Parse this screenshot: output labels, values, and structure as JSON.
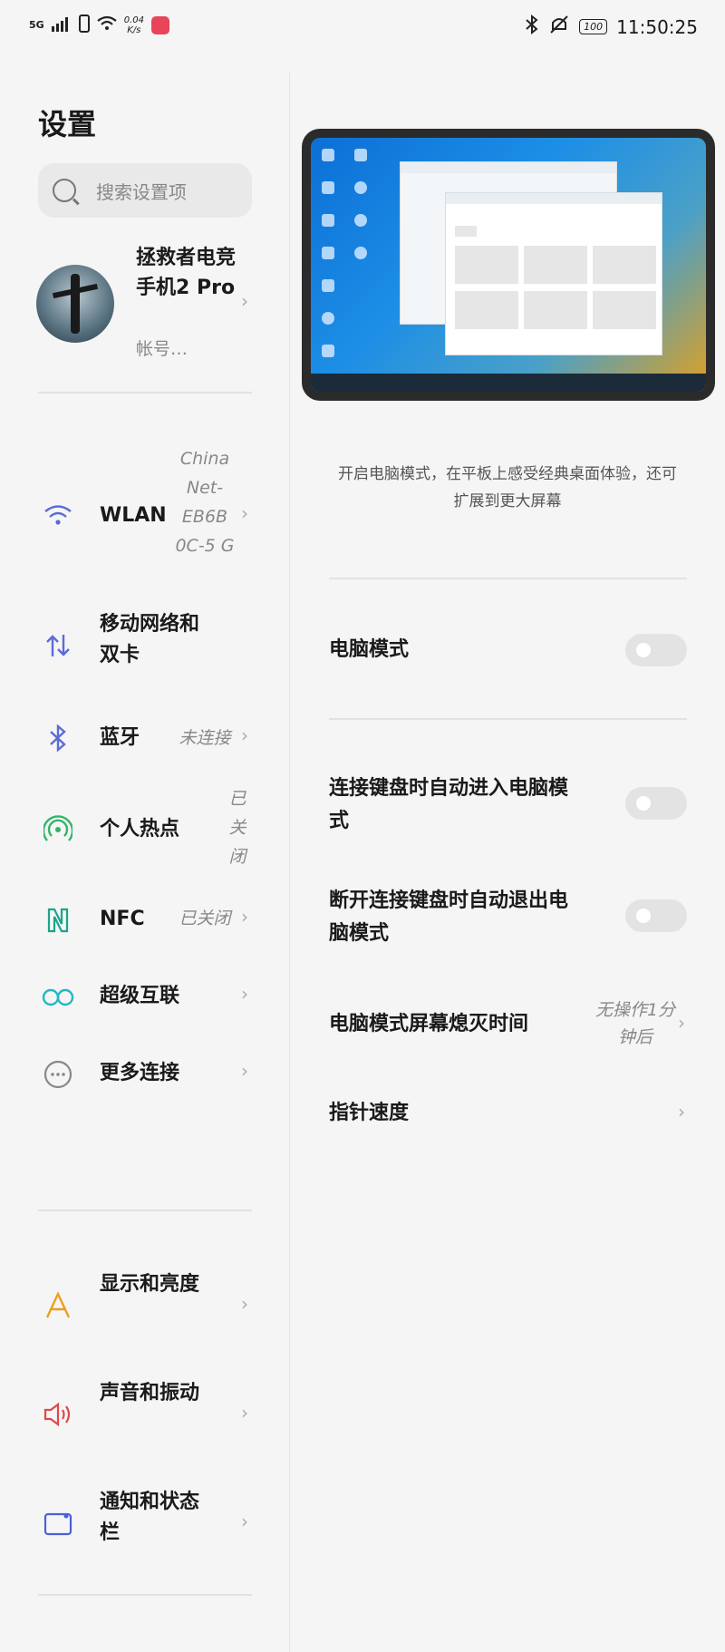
{
  "status_bar": {
    "network": "5G",
    "speed_value": "0.04",
    "speed_unit": "K/s",
    "battery": "100",
    "time": "11:50:25"
  },
  "left": {
    "title": "设置",
    "search_placeholder": "搜索设置项",
    "account": {
      "name": "拯救者电竞手机2 Pro",
      "subtitle": "帐号…"
    },
    "items": [
      {
        "label": "WLAN",
        "value": "China Net-EB6B 0C-5 G",
        "icon": "wifi-icon",
        "color": "#5b6bd8"
      },
      {
        "label": "移动网络和双卡",
        "value": "",
        "icon": "mobile-data-icon",
        "color": "#5b6bd8"
      },
      {
        "label": "蓝牙",
        "value": "未连接",
        "icon": "bluetooth-icon",
        "color": "#5b6bd8"
      },
      {
        "label": "个人热点",
        "value": "已关闭",
        "icon": "hotspot-icon",
        "color": "#2fb56a"
      },
      {
        "label": "NFC",
        "value": "已关闭",
        "icon": "nfc-icon",
        "color": "#1aa58a"
      },
      {
        "label": "超级互联",
        "value": "",
        "icon": "super-connect-icon",
        "color": "#22b8c8"
      },
      {
        "label": "更多连接",
        "value": "",
        "icon": "more-connections-icon",
        "color": "#888888"
      },
      {
        "label": "显示和亮度",
        "value": "",
        "icon": "display-icon",
        "color": "#e8a020"
      },
      {
        "label": "声音和振动",
        "value": "",
        "icon": "sound-icon",
        "color": "#e04848"
      },
      {
        "label": "通知和状态栏",
        "value": "",
        "icon": "notification-icon",
        "color": "#4a60d8"
      }
    ]
  },
  "right": {
    "description": "开启电脑模式，在平板上感受经典桌面体验，还可扩展到更大屏幕",
    "pc_mode_label": "电脑模式",
    "auto_enter_label": "连接键盘时自动进入电脑模式",
    "auto_exit_label": "断开连接键盘时自动退出电脑模式",
    "screen_off_label": "电脑模式屏幕熄灭时间",
    "screen_off_value": "无操作1分钟后",
    "pointer_speed_label": "指针速度"
  }
}
